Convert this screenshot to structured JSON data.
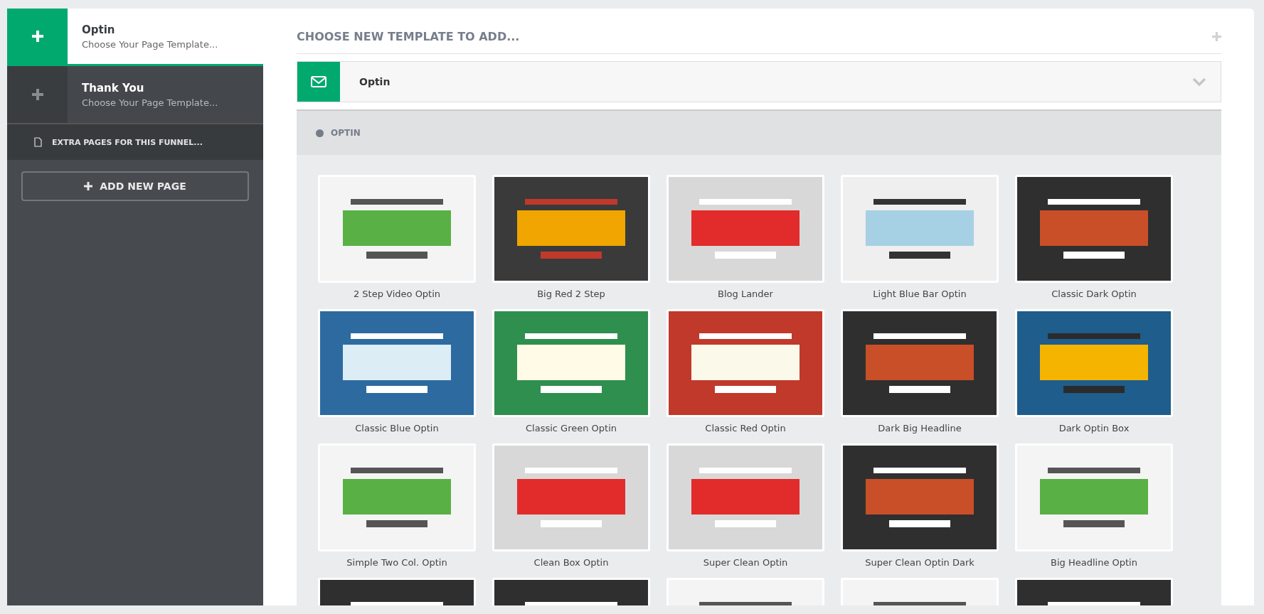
{
  "sidebar": {
    "pages": [
      {
        "title": "Optin",
        "subtitle": "Choose Your Page Template...",
        "selected": true
      },
      {
        "title": "Thank You",
        "subtitle": "Choose Your Page Template...",
        "selected": false
      }
    ],
    "extra_pages": "EXTRA PAGES FOR THIS FUNNEL...",
    "add_button": "ADD NEW PAGE"
  },
  "main": {
    "title": "CHOOSE NEW TEMPLATE TO ADD...",
    "category_select": {
      "value": "Optin"
    },
    "section": "OPTIN",
    "templates": [
      {
        "name": "2 Step Video Optin",
        "kind": "light"
      },
      {
        "name": "Big Red 2 Step",
        "kind": "dark-red"
      },
      {
        "name": "Blog Lander",
        "kind": "gray"
      },
      {
        "name": "Light Blue Bar Optin",
        "kind": "light-blue"
      },
      {
        "name": "Classic Dark Optin",
        "kind": "dark"
      },
      {
        "name": "Classic Blue Optin",
        "kind": "blue"
      },
      {
        "name": "Classic Green Optin",
        "kind": "green"
      },
      {
        "name": "Classic Red Optin",
        "kind": "red"
      },
      {
        "name": "Dark Big Headline",
        "kind": "dark"
      },
      {
        "name": "Dark Optin Box",
        "kind": "blue-box"
      },
      {
        "name": "Simple Two Col. Optin",
        "kind": "light"
      },
      {
        "name": "Clean Box Optin",
        "kind": "gray"
      },
      {
        "name": "Super Clean Optin",
        "kind": "gray"
      },
      {
        "name": "Super Clean Optin Dark",
        "kind": "dark"
      },
      {
        "name": "Big Headline Optin",
        "kind": "light"
      },
      {
        "kind": "dark"
      },
      {
        "kind": "dark"
      },
      {
        "kind": "light"
      },
      {
        "kind": "light"
      },
      {
        "kind": "dark"
      }
    ]
  }
}
